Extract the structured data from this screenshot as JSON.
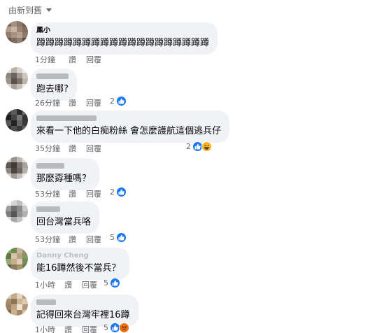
{
  "sort": {
    "label": "由新到舊"
  },
  "actions": {
    "like": "讚",
    "reply": "回覆"
  },
  "comments": [
    {
      "author": "鳳小",
      "text": "蹲蹲蹲蹲蹲蹲蹲蹲蹲蹲蹲蹲蹲蹲蹲蹲蹲蹲蹲",
      "time": "1分鐘",
      "reactions": {
        "count": "",
        "types": []
      }
    },
    {
      "author": "",
      "text": "跑去哪?",
      "time": "26分鐘",
      "reactions": {
        "count": "2",
        "types": [
          "like"
        ]
      }
    },
    {
      "author": "",
      "text": "來看一下他的白痴粉絲 會怎麼護航這個逃兵仔",
      "time": "35分鐘",
      "reactions": {
        "count": "2",
        "types": [
          "like",
          "haha"
        ]
      }
    },
    {
      "author": "",
      "text": "那麼孬種嗎？",
      "time": "53分鐘",
      "reactions": {
        "count": "2",
        "types": [
          "like"
        ]
      }
    },
    {
      "author": "",
      "text": "回台灣當兵咯",
      "time": "53分鐘",
      "reactions": {
        "count": "5",
        "types": [
          "like"
        ]
      }
    },
    {
      "author": "Danny Cheng",
      "text": "能16蹲然後不當兵？",
      "time": "1小時",
      "reactions": {
        "count": "5",
        "types": [
          "like"
        ]
      }
    },
    {
      "author": "",
      "text": "記得回來台灣牢裡16蹲",
      "time": "1小時",
      "reactions": {
        "count": "5",
        "types": [
          "like",
          "angry"
        ]
      }
    }
  ]
}
